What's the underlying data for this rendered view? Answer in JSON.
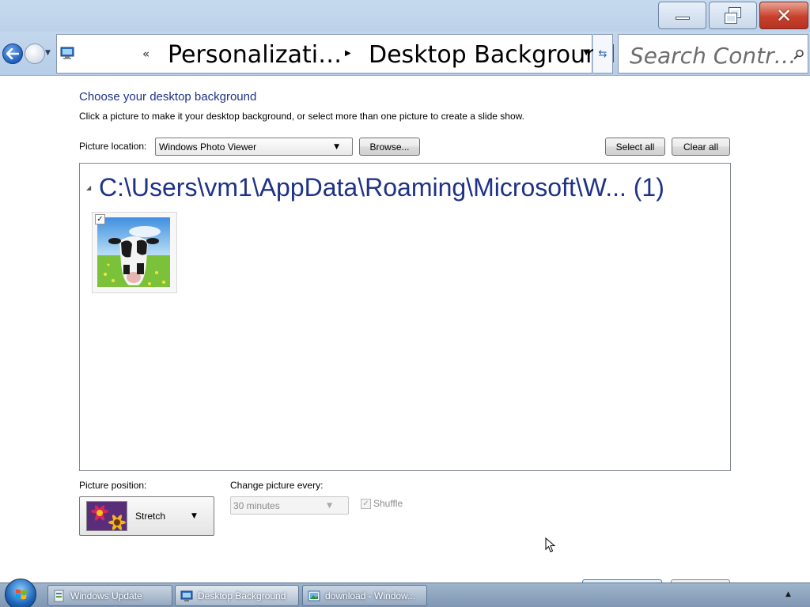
{
  "window": {
    "controls": {
      "minimize": "minimize",
      "maximize": "restore",
      "close": "close"
    }
  },
  "nav": {
    "breadcrumb_overflow": "«",
    "crumb1": "Personalizati…",
    "crumb2": "Desktop Background",
    "search_placeholder": "Search Contr…"
  },
  "main": {
    "heading": "Choose your desktop background",
    "description": "Click a picture to make it your desktop background, or select more than one picture to create a slide show.",
    "picture_location_label": "Picture location:",
    "picture_location_value": "Windows Photo Viewer",
    "browse_label": "Browse...",
    "select_all_label": "Select all",
    "clear_all_label": "Clear all",
    "group_header": "C:\\Users\\vm1\\AppData\\Roaming\\Microsoft\\W... (1)",
    "thumbnails": [
      {
        "checked": true,
        "icon": "cow-picture"
      }
    ],
    "picture_position_label": "Picture position:",
    "picture_position_value": "Stretch",
    "change_picture_label": "Change picture every:",
    "change_picture_value": "30 minutes",
    "shuffle_label": "Shuffle",
    "shuffle_checked": true
  },
  "taskbar": {
    "items": [
      {
        "label": "Windows Update",
        "icon": "windows-update-icon",
        "active": false
      },
      {
        "label": "Desktop Background",
        "icon": "control-panel-icon",
        "active": true
      },
      {
        "label": "download - Window...",
        "icon": "photo-viewer-icon",
        "active": false
      }
    ]
  },
  "colors": {
    "heading_blue": "#1e3287",
    "titlebar": "#c6d9ee",
    "close_red": "#c9402c"
  }
}
